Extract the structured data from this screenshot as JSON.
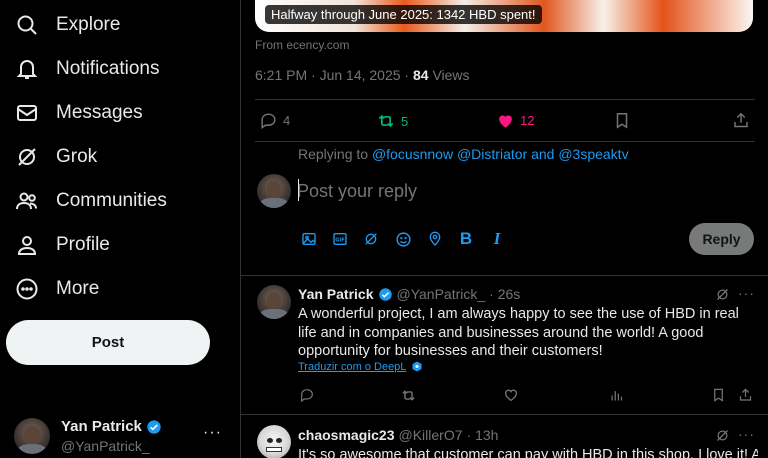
{
  "sidebar": {
    "items": [
      {
        "label": "Explore",
        "icon": "search-icon"
      },
      {
        "label": "Notifications",
        "icon": "bell-icon"
      },
      {
        "label": "Messages",
        "icon": "envelope-icon"
      },
      {
        "label": "Grok",
        "icon": "grok-icon"
      },
      {
        "label": "Communities",
        "icon": "people-icon"
      },
      {
        "label": "Profile",
        "icon": "person-icon"
      },
      {
        "label": "More",
        "icon": "more-circle-icon"
      }
    ],
    "post_label": "Post",
    "account": {
      "name": "Yan Patrick",
      "handle": "@YanPatrick_",
      "more": "···"
    }
  },
  "post": {
    "card_caption": "Halfway through June 2025: 1342 HBD spent!",
    "card_source": "From ecency.com",
    "timestamp": "6:21 PM · Jun 14, 2025 · ",
    "views_count": "84",
    "views_label": " Views",
    "replies": "4",
    "reposts": "5",
    "likes": "12"
  },
  "reply_box": {
    "replying_prefix": "Replying to ",
    "mentions": "@focusnnow @Distriator and @3speaktv",
    "placeholder": "Post your reply",
    "button_label": "Reply"
  },
  "replies": [
    {
      "name": "Yan Patrick",
      "handle": "@YanPatrick_",
      "time": "· 26s",
      "text": "A wonderful project, I am always happy to see the use of HBD in real life and in companies and businesses around the world! A good opportunity for businesses and their customers!",
      "translate": "Traduzir com o DeepL"
    },
    {
      "name": "chaosmagic23",
      "handle": "@KillerO7",
      "time": "· 13h",
      "text": "It's so awesome that customer can pay with HBD in this shop. I love it! And"
    }
  ],
  "colors": {
    "background": "#000000",
    "accent_blue": "#1d9bf0",
    "repost_green": "#00ba7c",
    "like_pink": "#f91880",
    "muted": "#71767b"
  }
}
